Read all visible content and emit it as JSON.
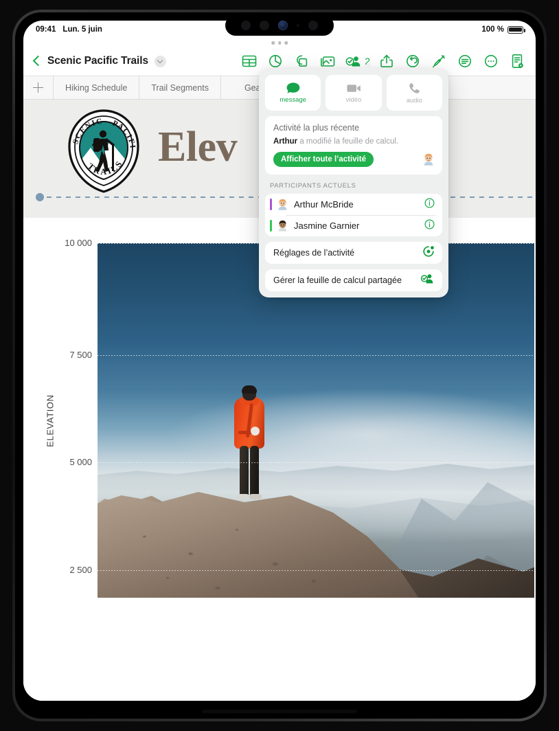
{
  "status_bar": {
    "time": "09:41",
    "date": "Lun. 5 juin",
    "battery_text": "100 %"
  },
  "toolbar": {
    "document_title": "Scenic Pacific Trails",
    "back_icon": "chevron-left-icon",
    "title_chevron_icon": "chevron-down-icon",
    "collaborator_count": "2",
    "icons": [
      {
        "name": "table-icon",
        "glyph": "table"
      },
      {
        "name": "chart-icon",
        "glyph": "chart"
      },
      {
        "name": "shape-icon",
        "glyph": "shape"
      },
      {
        "name": "media-icon",
        "glyph": "media"
      },
      {
        "name": "collaborate-icon",
        "glyph": "collaborate"
      },
      {
        "name": "share-icon",
        "glyph": "share"
      },
      {
        "name": "undo-icon",
        "glyph": "undo"
      },
      {
        "name": "format-brush-icon",
        "glyph": "brush"
      },
      {
        "name": "comment-icon",
        "glyph": "comment"
      },
      {
        "name": "more-icon",
        "glyph": "more"
      },
      {
        "name": "document-icon",
        "glyph": "document"
      }
    ]
  },
  "sheet_tabs": {
    "add_label": "+",
    "tabs": [
      {
        "label": "Hiking Schedule",
        "active": false
      },
      {
        "label": "Trail Segments",
        "active": false
      },
      {
        "label": "Gear",
        "active": false
      }
    ]
  },
  "document": {
    "logo_text_top_left": "SCENIC",
    "logo_text_top_right": "PACIFIC",
    "logo_text_bottom": "TRAILS",
    "heading": "Elev"
  },
  "chart_data": {
    "type": "area",
    "title": "Elev",
    "ylabel": "ELEVATION",
    "xlabel": "",
    "yticks": [
      "10 000",
      "7 500",
      "5 000",
      "2 500"
    ],
    "ytick_values": [
      10000,
      7500,
      5000,
      2500
    ],
    "ylim": [
      0,
      10000
    ],
    "grid": true,
    "legend": "none",
    "fill_image": "mountain-hiker-photo",
    "categories": [],
    "values": []
  },
  "popover": {
    "call_buttons": [
      {
        "label": "message",
        "icon": "message-bubble-icon",
        "state": "active"
      },
      {
        "label": "vidéo",
        "icon": "video-camera-icon",
        "state": "dim"
      },
      {
        "label": "audio",
        "icon": "phone-icon",
        "state": "dim"
      }
    ],
    "activity": {
      "title": "Activité la plus récente",
      "actor": "Arthur",
      "message": " a modifié la feuille de calcul.",
      "show_all_label": "Afficher toute l’activité",
      "avatar": "memoji-arthur"
    },
    "participants_header": "PARTICIPANTS ACTUELS",
    "participants": [
      {
        "name": "Arthur McBride",
        "color": "#a855d6",
        "avatar": "memoji-arthur",
        "info_icon": "info-circle-icon"
      },
      {
        "name": "Jasmine Garnier",
        "color": "#34c759",
        "avatar": "memoji-jasmine",
        "info_icon": "info-circle-icon"
      }
    ],
    "actions": [
      {
        "label": "Réglages de l’activité",
        "icon": "activity-settings-icon"
      },
      {
        "label": "Gérer la feuille de calcul partagée",
        "icon": "manage-share-icon"
      }
    ]
  },
  "colors": {
    "accent_green": "#17a84a",
    "button_green": "#22b14c",
    "heading_brown": "#7a6a5c",
    "logo_teal": "#1d8a84",
    "dash_blue": "#7b9bb4"
  }
}
